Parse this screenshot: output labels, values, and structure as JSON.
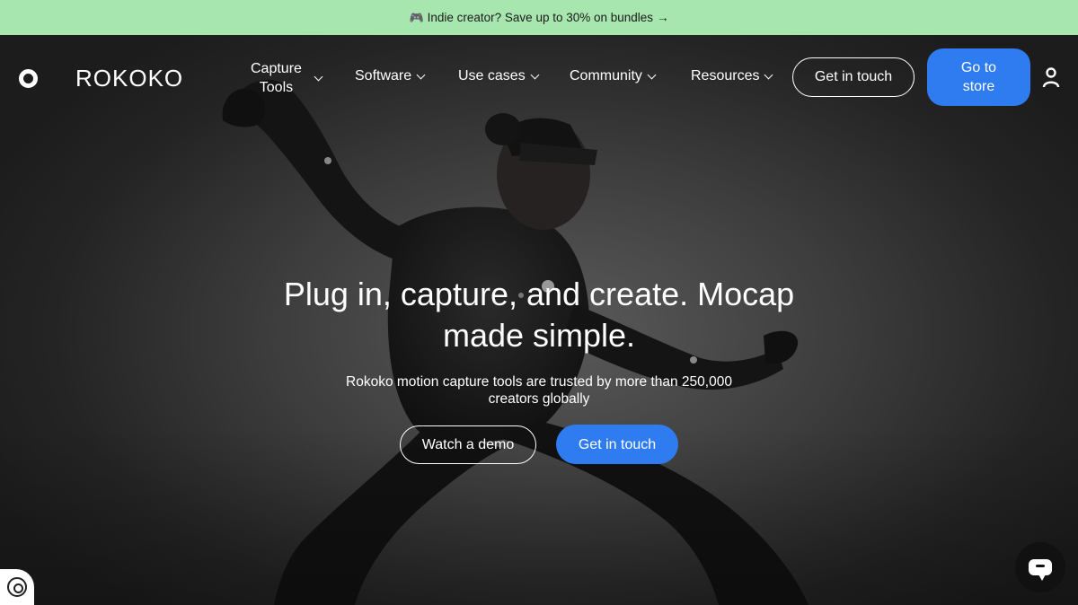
{
  "promo": {
    "icon": "gamepad-icon",
    "text": "Indie creator? Save up to 30% on bundles",
    "arrow": "→"
  },
  "nav": {
    "logo_text": "ROKOKO",
    "items": [
      {
        "label_line1": "Capture",
        "label_line2": "Tools"
      },
      {
        "label": "Software"
      },
      {
        "label": "Use cases"
      },
      {
        "label": "Community"
      },
      {
        "label": "Resources"
      }
    ],
    "get_in_touch": "Get in touch",
    "store_line1": "Go to",
    "store_line2": "store"
  },
  "hero": {
    "headline_line1": "Plug in, capture, and create. Mocap",
    "headline_line2": "made simple.",
    "subtext_line1": "Rokoko motion capture tools are trusted by more than 250,000",
    "subtext_line2": "creators globally",
    "watch_demo": "Watch a demo",
    "get_in_touch": "Get in touch"
  },
  "colors": {
    "promo_bg": "#a8e6b0",
    "accent_blue": "#2e7cf0",
    "hero_bg": "#3d3d3d"
  }
}
